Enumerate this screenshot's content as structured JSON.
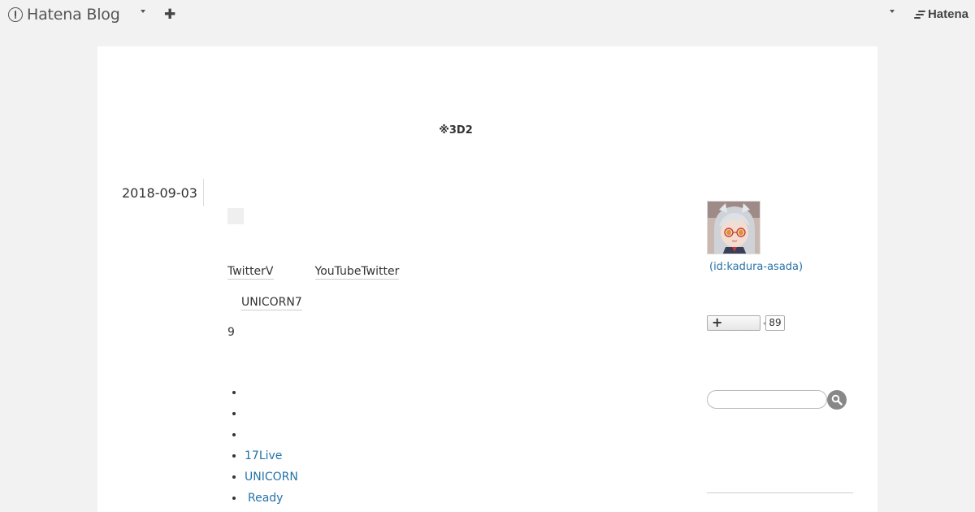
{
  "topbar": {
    "brand_name": "Hatena Blog",
    "hatena_name": "Hatena"
  },
  "blog": {
    "title": "※3D2"
  },
  "entry": {
    "date": "2018-09-03",
    "line1_a": "TwitterV",
    "line1_b": "YouTubeTwitter",
    "line2": "UNICORN7",
    "line3": "9",
    "list_links": [
      "17Live",
      "UNICORN",
      "Ready"
    ]
  },
  "sidebar": {
    "profile_id": "(id:kadura-asada)",
    "reader_count": "89",
    "search_placeholder": ""
  },
  "colors": {
    "link": "#2573a8",
    "background": "#f2f2f2",
    "card": "#ffffff"
  }
}
